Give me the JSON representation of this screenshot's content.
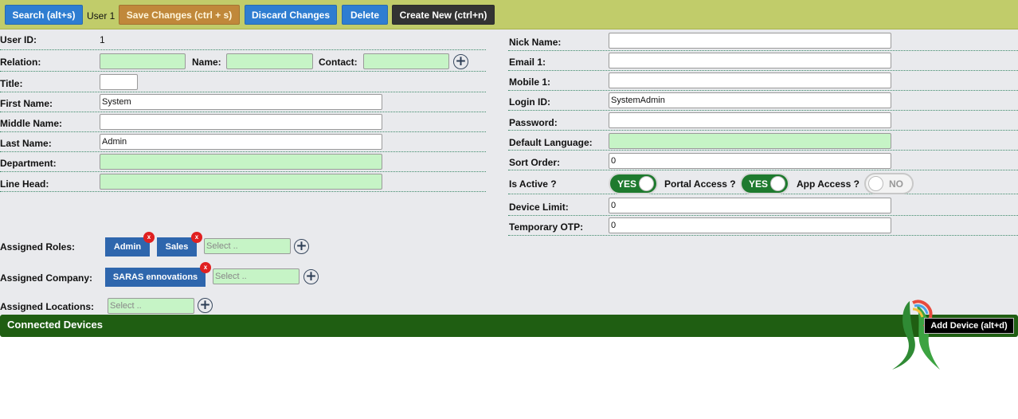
{
  "toolbar": {
    "search_label": "Search (alt+s)",
    "user_label": "User 1",
    "save_label": "Save Changes (ctrl + s)",
    "discard_label": "Discard Changes",
    "delete_label": "Delete",
    "create_label": "Create New (ctrl+n)"
  },
  "left": {
    "user_id_label": "User ID:",
    "user_id_value": "1",
    "relation_label": "Relation:",
    "relation_value": "",
    "name_label": "Name:",
    "name_value": "",
    "contact_label": "Contact:",
    "contact_value": "",
    "title_label": "Title:",
    "title_value": "",
    "first_name_label": "First Name:",
    "first_name_value": "System",
    "middle_name_label": "Middle Name:",
    "middle_name_value": "",
    "last_name_label": "Last Name:",
    "last_name_value": "Admin",
    "department_label": "Department:",
    "department_value": "",
    "line_head_label": "Line Head:",
    "line_head_value": ""
  },
  "right": {
    "nick_name_label": "Nick Name:",
    "nick_name_value": "",
    "email1_label": "Email 1:",
    "email1_value": "",
    "mobile1_label": "Mobile 1:",
    "mobile1_value": "",
    "login_id_label": "Login ID:",
    "login_id_value": "SystemAdmin",
    "password_label": "Password:",
    "password_value": "",
    "default_language_label": "Default Language:",
    "default_language_value": "",
    "sort_order_label": "Sort Order:",
    "sort_order_value": "0",
    "is_active_label": "Is Active ?",
    "is_active_state": "YES",
    "portal_access_label": "Portal Access ?",
    "portal_access_state": "YES",
    "app_access_label": "App Access ?",
    "app_access_state": "NO",
    "device_limit_label": "Device Limit:",
    "device_limit_value": "0",
    "temporary_otp_label": "Temporary OTP:",
    "temporary_otp_value": "0"
  },
  "assignments": {
    "roles_label": "Assigned Roles:",
    "roles": [
      "Admin",
      "Sales"
    ],
    "roles_placeholder": "Select ..",
    "company_label": "Assigned Company:",
    "companies": [
      "SARAS ennovations"
    ],
    "company_placeholder": "Select ..",
    "locations_label": "Assigned Locations:",
    "locations_placeholder": "Select ..",
    "remove_glyph": "x"
  },
  "devices": {
    "title": "Connected Devices",
    "add_label": "Add Device (alt+d)"
  },
  "colors": {
    "toolbar_bg": "#c1cc6a",
    "primary_button": "#2e7dd1",
    "save_button": "#c0883a",
    "create_button": "#333333",
    "lookup_field": "#c6f4c6",
    "toggle_on": "#1e7a2e",
    "tag_bg": "#2e66ad",
    "devices_bar": "#1f5e12"
  }
}
